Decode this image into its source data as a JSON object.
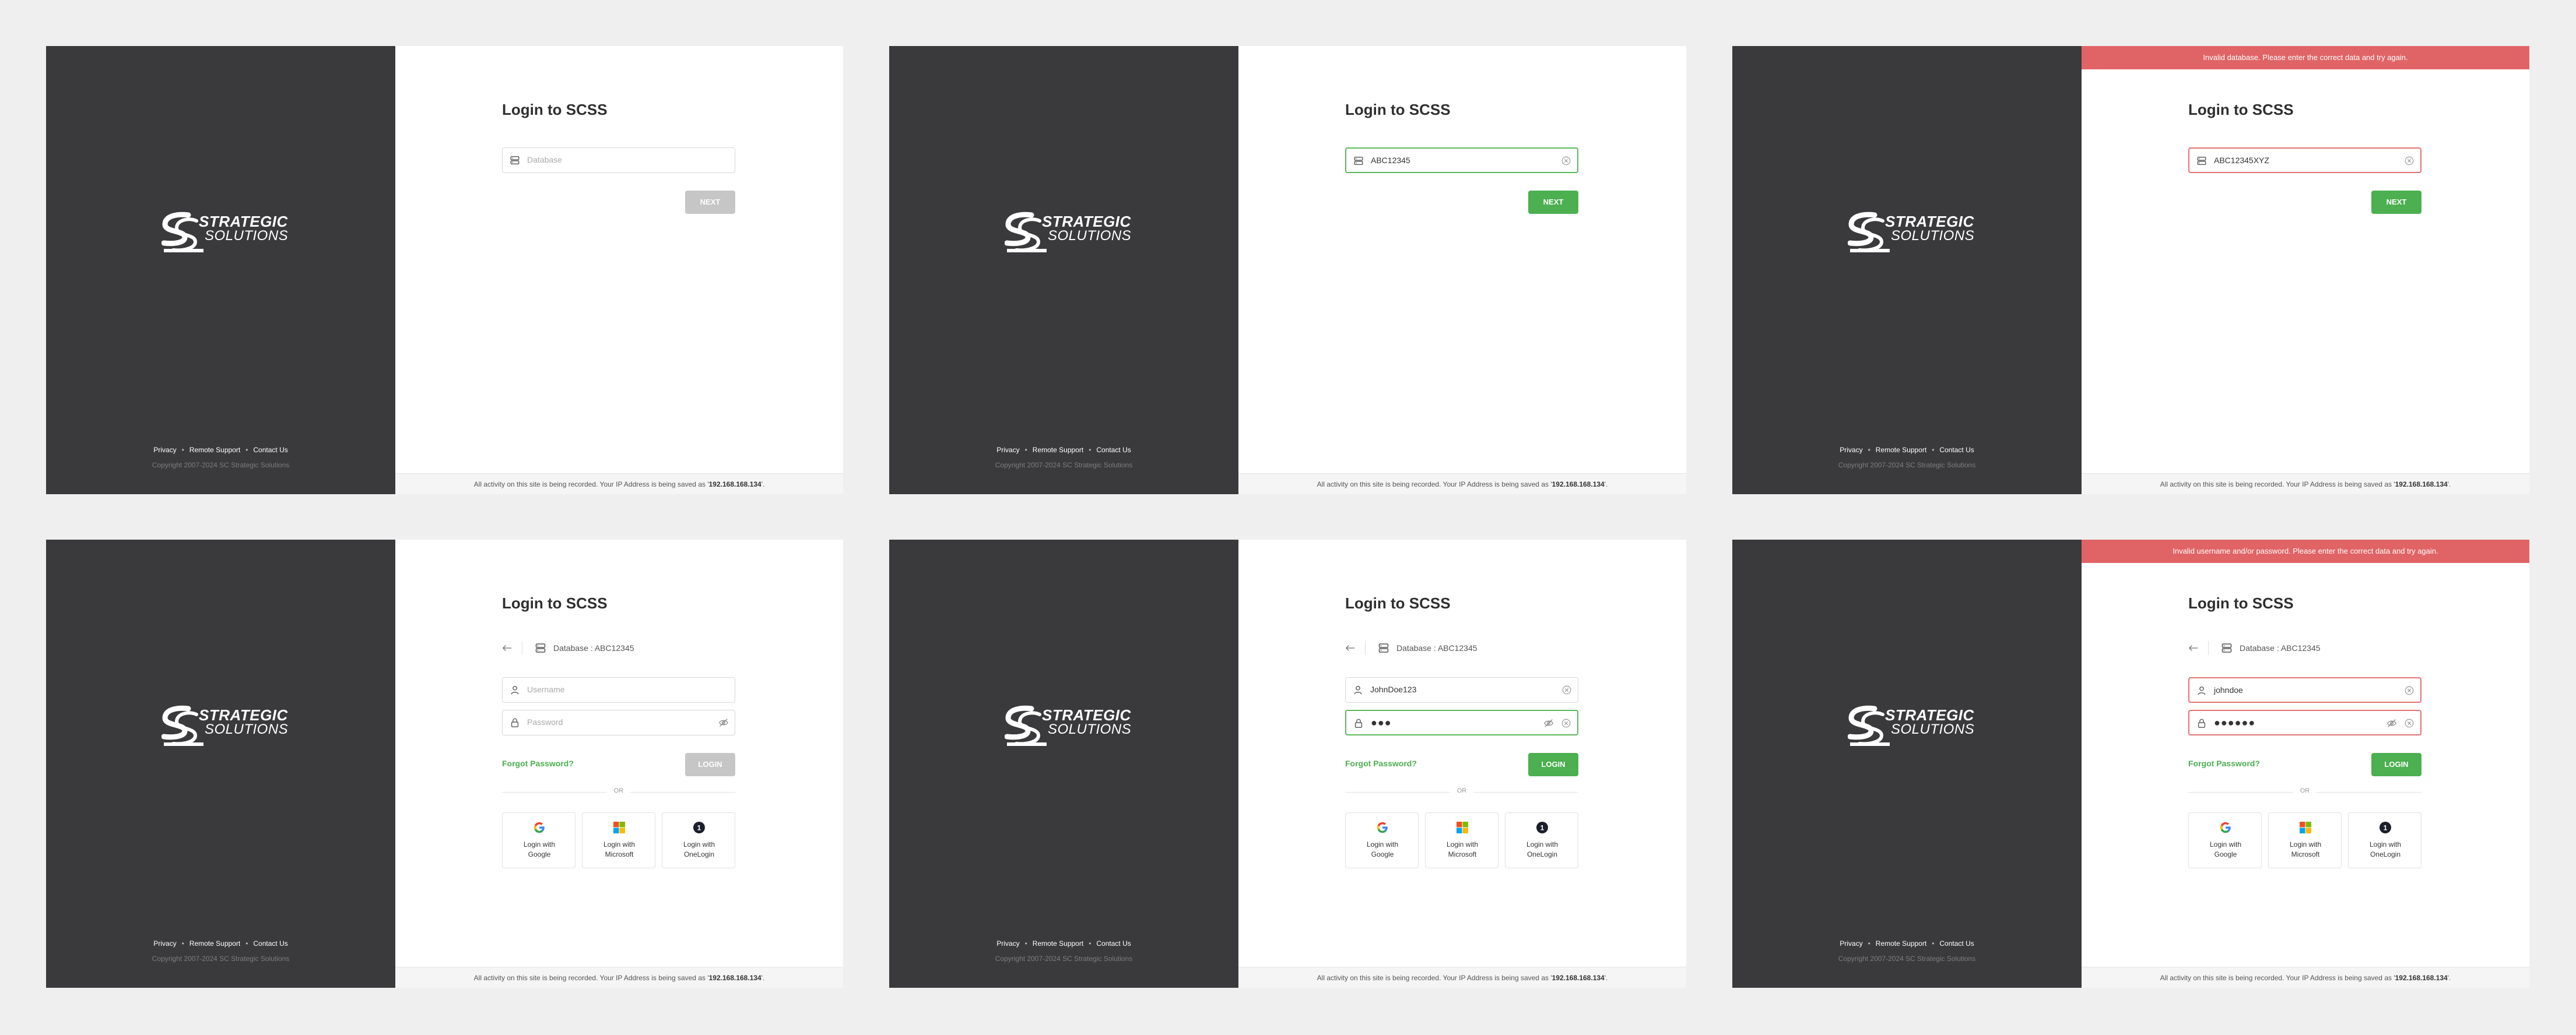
{
  "common": {
    "title": "Login to SCSS",
    "logo_line1": "STRATEGIC",
    "logo_line2": "SOLUTIONS",
    "privacy": "Privacy",
    "remote_support": "Remote Support",
    "contact_us": "Contact Us",
    "copyright": "Copyright 2007-2024 SC Strategic Solutions",
    "footer_prefix": "All activity on this site is being recorded. Your IP Address is being saved as '",
    "footer_ip": "192.168.168.134",
    "footer_suffix": "'.",
    "db_placeholder": "Database",
    "username_placeholder": "Username",
    "password_placeholder": "Password",
    "next_label": "NEXT",
    "login_label": "LOGIN",
    "forgot_label": "Forgot Password?",
    "or_label": "OR",
    "db_prefix": "Database : ",
    "db_name": "ABC12345",
    "google_label": "Login with Google",
    "microsoft_label": "Login with Microsoft",
    "onelogin_label": "Login with OneLogin",
    "google_line1": "Login with",
    "google_line2": "Google",
    "microsoft_line1": "Login with",
    "microsoft_line2": "Microsoft",
    "onelogin_line1": "Login with",
    "onelogin_line2": "OneLogin"
  },
  "panels": [
    {
      "step": "database",
      "state": "empty",
      "db_value": ""
    },
    {
      "step": "database",
      "state": "valid",
      "db_value": "ABC12345"
    },
    {
      "step": "database",
      "state": "error",
      "db_value": "ABC12345XYZ",
      "alert": "Invalid database. Please enter the correct data and try again."
    },
    {
      "step": "credentials",
      "state": "empty",
      "username": "",
      "password_dots": ""
    },
    {
      "step": "credentials",
      "state": "valid",
      "username": "JohnDoe123",
      "password_dots": "●●●"
    },
    {
      "step": "credentials",
      "state": "error",
      "username": "johndoe",
      "password_dots": "●●●●●●",
      "alert": "Invalid username and/or password. Please enter the correct data and try again."
    }
  ],
  "colors": {
    "brand_bg": "#3a3a3c",
    "accent_green": "#4caf50",
    "error_red": "#e06466",
    "disabled_gray": "#c6c6c6"
  },
  "icons": {
    "database": "database-icon",
    "user": "user-icon",
    "lock": "lock-icon",
    "eye": "eye-slash-icon",
    "clear": "clear-icon",
    "back": "back-arrow-icon",
    "google": "google-icon",
    "microsoft": "microsoft-icon",
    "onelogin": "onelogin-icon"
  }
}
